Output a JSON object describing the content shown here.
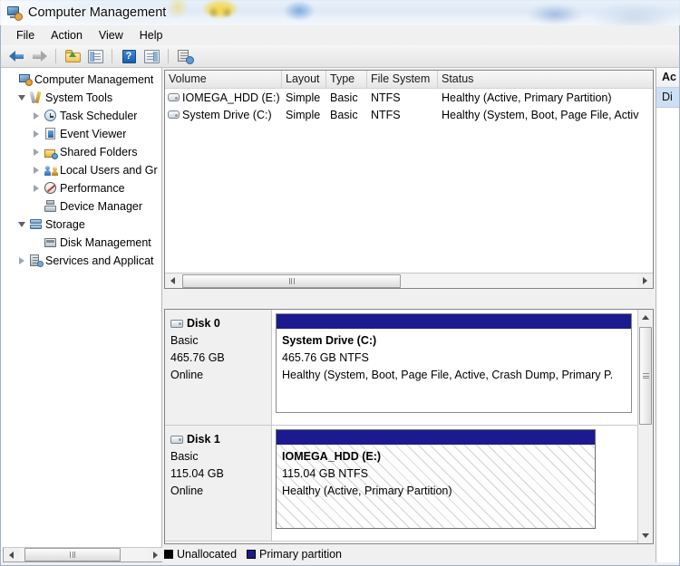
{
  "window": {
    "title": "Computer Management",
    "icon": "computer-management-icon"
  },
  "menubar": {
    "items": [
      {
        "label": "File"
      },
      {
        "label": "Action"
      },
      {
        "label": "View"
      },
      {
        "label": "Help"
      }
    ]
  },
  "toolbar": {
    "buttons": [
      {
        "icon": "back-arrow-icon",
        "label": "Back"
      },
      {
        "icon": "forward-arrow-icon",
        "label": "Forward"
      },
      {
        "icon": "up-folder-icon",
        "label": "Up One Level"
      },
      {
        "icon": "show-hide-console-tree-icon",
        "label": "Show/Hide Console Tree"
      },
      {
        "icon": "help-icon",
        "label": "Help"
      },
      {
        "icon": "show-hide-action-pane-icon",
        "label": "Show/Hide Action Pane"
      },
      {
        "icon": "refresh-icon",
        "label": "Refresh"
      }
    ]
  },
  "tree": {
    "items": [
      {
        "label": "Computer Management",
        "icon": "computer-icon",
        "indent": 0,
        "expander": "none",
        "selected": false
      },
      {
        "label": "System Tools",
        "icon": "system-tools-icon",
        "indent": 1,
        "expander": "open",
        "selected": false
      },
      {
        "label": "Task Scheduler",
        "icon": "task-scheduler-icon",
        "indent": 2,
        "expander": "closed",
        "selected": false
      },
      {
        "label": "Event Viewer",
        "icon": "event-viewer-icon",
        "indent": 2,
        "expander": "closed",
        "selected": false
      },
      {
        "label": "Shared Folders",
        "icon": "shared-folders-icon",
        "indent": 2,
        "expander": "closed",
        "selected": false
      },
      {
        "label": "Local Users and Gr",
        "icon": "local-users-icon",
        "indent": 2,
        "expander": "closed",
        "selected": false
      },
      {
        "label": "Performance",
        "icon": "performance-icon",
        "indent": 2,
        "expander": "closed",
        "selected": false
      },
      {
        "label": "Device Manager",
        "icon": "device-manager-icon",
        "indent": 2,
        "expander": "none",
        "selected": false
      },
      {
        "label": "Storage",
        "icon": "storage-icon",
        "indent": 1,
        "expander": "open",
        "selected": false
      },
      {
        "label": "Disk Management",
        "icon": "disk-management-icon",
        "indent": 2,
        "expander": "none",
        "selected": true
      },
      {
        "label": "Services and Applicat",
        "icon": "services-icon",
        "indent": 1,
        "expander": "closed",
        "selected": false
      }
    ]
  },
  "volume_list": {
    "columns": [
      "Volume",
      "Layout",
      "Type",
      "File System",
      "Status"
    ],
    "rows": [
      {
        "volume": "IOMEGA_HDD (E:)",
        "layout": "Simple",
        "type": "Basic",
        "file_system": "NTFS",
        "status": "Healthy (Active, Primary Partition)"
      },
      {
        "volume": "System Drive (C:)",
        "layout": "Simple",
        "type": "Basic",
        "file_system": "NTFS",
        "status": "Healthy (System, Boot, Page File, Activ"
      }
    ]
  },
  "disk_view": {
    "disks": [
      {
        "name": "Disk 0",
        "kind": "Basic",
        "capacity": "465.76 GB",
        "state": "Online",
        "partition": {
          "label": "System Drive  (C:)",
          "size": "465.76 GB NTFS",
          "status": "Healthy (System, Boot, Page File, Active, Crash Dump, Primary P.",
          "selected": false
        }
      },
      {
        "name": "Disk 1",
        "kind": "Basic",
        "capacity": "115.04 GB",
        "state": "Online",
        "partition": {
          "label": "IOMEGA_HDD  (E:)",
          "size": "115.04 GB NTFS",
          "status": "Healthy (Active, Primary Partition)",
          "selected": true
        }
      }
    ]
  },
  "legend": {
    "items": [
      {
        "label": "Unallocated",
        "color": "#000000"
      },
      {
        "label": "Primary partition",
        "color": "#1b1b8f"
      }
    ]
  },
  "actions_pane": {
    "header": "Ac",
    "selected_item": "Di"
  },
  "colors": {
    "partition_bar": "#1b1b8f",
    "selection_blue": "#cddff2",
    "window_chrome": "#f0f0f0"
  }
}
